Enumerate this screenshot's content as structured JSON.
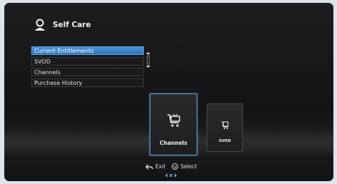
{
  "header": {
    "title": "Self Care",
    "icon": "user-icon"
  },
  "menu": {
    "items": [
      {
        "label": "Current Entitlements",
        "active": true
      },
      {
        "label": "SVOD",
        "active": false
      },
      {
        "label": "Channels",
        "active": false
      },
      {
        "label": "Purchase History",
        "active": false
      }
    ]
  },
  "cards": [
    {
      "label": "Channels",
      "icon": "tv-cart-icon",
      "selected": true
    },
    {
      "label": "SVOD",
      "icon": "film-cart-icon",
      "selected": false
    }
  ],
  "footer": {
    "exit_label": "Exit",
    "select_label": "Select",
    "ok_text": "OK"
  },
  "colors": {
    "accent": "#3a82c9",
    "background": "#161618",
    "text": "#f2f2f2"
  }
}
